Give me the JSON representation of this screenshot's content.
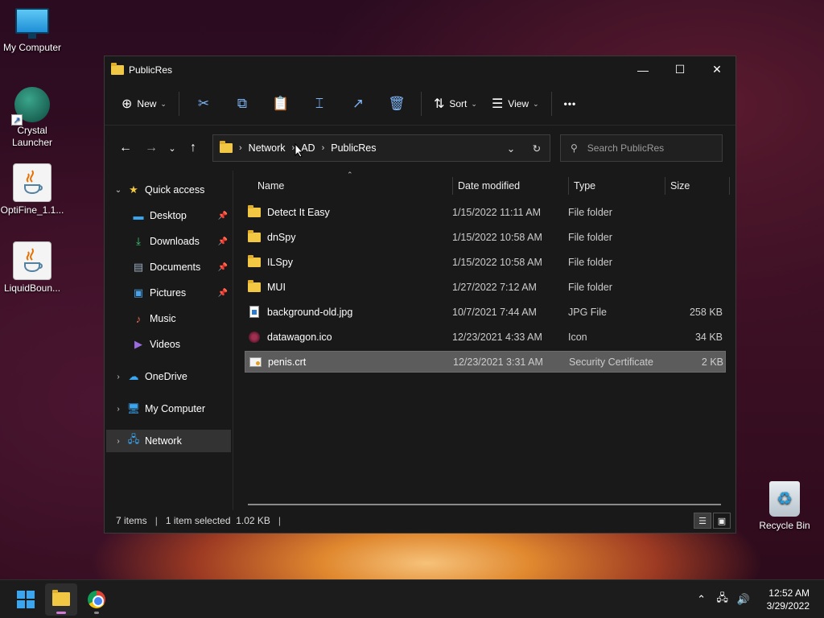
{
  "desktop": {
    "icons": [
      {
        "label": "My Computer"
      },
      {
        "label": "Crystal Launcher"
      },
      {
        "label": "OptiFine_1.1..."
      },
      {
        "label": "LiquidBoun..."
      },
      {
        "label": "Recycle Bin"
      }
    ]
  },
  "window": {
    "title": "PublicRes",
    "controls": {
      "minimize": "—",
      "maximize": "☐",
      "close": "✕"
    }
  },
  "commandbar": {
    "new_label": "New",
    "sort_label": "Sort",
    "view_label": "View",
    "more_label": "•••"
  },
  "address": {
    "crumbs": [
      "Network",
      "AD",
      "PublicRes"
    ]
  },
  "search": {
    "placeholder": "Search PublicRes"
  },
  "sidebar": {
    "items": [
      {
        "label": "Quick access",
        "icon": "star-icon"
      },
      {
        "label": "Desktop",
        "icon": "desktop-icon"
      },
      {
        "label": "Downloads",
        "icon": "download-icon"
      },
      {
        "label": "Documents",
        "icon": "documents-icon"
      },
      {
        "label": "Pictures",
        "icon": "pictures-icon"
      },
      {
        "label": "Music",
        "icon": "music-icon"
      },
      {
        "label": "Videos",
        "icon": "videos-icon"
      },
      {
        "label": "OneDrive",
        "icon": "cloud-icon"
      },
      {
        "label": "My Computer",
        "icon": "computer-icon"
      },
      {
        "label": "Network",
        "icon": "network-icon"
      }
    ]
  },
  "columns": {
    "name": "Name",
    "date": "Date modified",
    "type": "Type",
    "size": "Size"
  },
  "files": [
    {
      "name": "Detect It Easy",
      "date": "1/15/2022 11:11 AM",
      "type": "File folder",
      "size": ""
    },
    {
      "name": "dnSpy",
      "date": "1/15/2022 10:58 AM",
      "type": "File folder",
      "size": ""
    },
    {
      "name": "ILSpy",
      "date": "1/15/2022 10:58 AM",
      "type": "File folder",
      "size": ""
    },
    {
      "name": "MUI",
      "date": "1/27/2022 7:12 AM",
      "type": "File folder",
      "size": ""
    },
    {
      "name": "background-old.jpg",
      "date": "10/7/2021 7:44 AM",
      "type": "JPG File",
      "size": "258 KB"
    },
    {
      "name": "datawagon.ico",
      "date": "12/23/2021 4:33 AM",
      "type": "Icon",
      "size": "34 KB"
    },
    {
      "name": "penis.crt",
      "date": "12/23/2021 3:31 AM",
      "type": "Security Certificate",
      "size": "2 KB"
    }
  ],
  "status": {
    "count": "7 items",
    "selection": "1 item selected  1.02 KB"
  },
  "taskbar": {
    "time": "12:52 AM",
    "date": "3/29/2022"
  },
  "colors": {
    "accent": "#7fb5f5",
    "window_bg": "#191919",
    "selected_row": "#5c5c5c",
    "folder": "#f2c744"
  }
}
